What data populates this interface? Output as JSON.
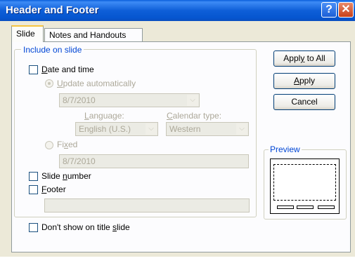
{
  "window": {
    "title": "Header and Footer",
    "help_glyph": "?",
    "close_glyph": "✕"
  },
  "tabs": [
    {
      "label": "Slide",
      "active": true
    },
    {
      "label": "Notes and Handouts",
      "active": false
    }
  ],
  "include_group": {
    "legend": "Include on slide",
    "date_time": {
      "pre": "",
      "ak": "D",
      "post": "ate and time",
      "checked": false
    },
    "update_auto": {
      "pre": "",
      "ak": "U",
      "post": "pdate automatically",
      "selected": true,
      "enabled": false
    },
    "date_value": "8/7/2010",
    "language_label": {
      "pre": "",
      "ak": "L",
      "post": "anguage:"
    },
    "calendar_label": {
      "pre": "",
      "ak": "C",
      "post": "alendar type:"
    },
    "language_value": "English (U.S.)",
    "calendar_value": "Western",
    "fixed": {
      "pre": "Fi",
      "ak": "x",
      "post": "ed",
      "selected": false,
      "enabled": false
    },
    "fixed_value": "8/7/2010",
    "slide_number": {
      "pre": "Slide ",
      "ak": "n",
      "post": "umber",
      "checked": false
    },
    "footer": {
      "pre": "",
      "ak": "F",
      "post": "ooter",
      "checked": false
    },
    "footer_value": "",
    "dont_show": {
      "pre": "Don't show on title ",
      "ak": "s",
      "post": "lide",
      "checked": false
    }
  },
  "buttons": {
    "apply_all": {
      "pre": "Appl",
      "ak": "y",
      "post": " to All"
    },
    "apply": {
      "pre": "",
      "ak": "A",
      "post": "pply"
    },
    "cancel": {
      "pre": "Cancel",
      "ak": "",
      "post": ""
    }
  },
  "preview": {
    "legend": "Preview"
  },
  "icons": {
    "dropdown": "chevron-down-icon"
  },
  "colors": {
    "title_bar": "#0a5fdc",
    "legend_text": "#0046d5",
    "disabled_text": "#aca899"
  }
}
